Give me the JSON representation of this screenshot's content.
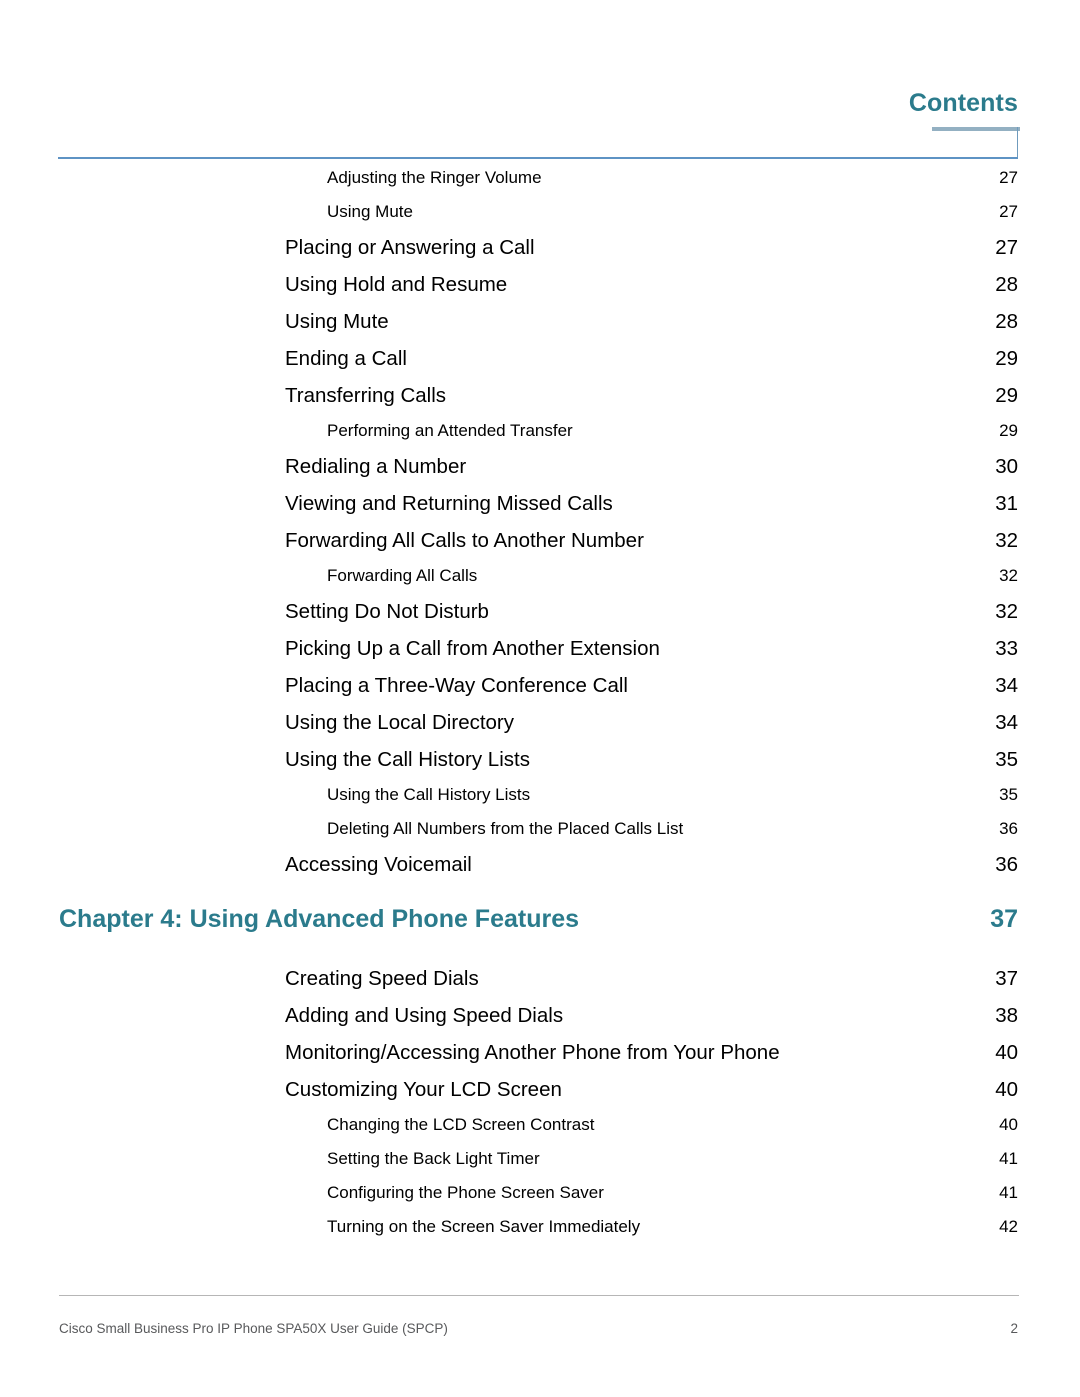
{
  "header": {
    "title": "Contents",
    "accent_color": "#2b7b8c",
    "bar_color": "#93b0c2",
    "rule_color": "#5e93c4"
  },
  "toc": {
    "entries": [
      {
        "level": 2,
        "label": "Adjusting the Ringer Volume",
        "page": "27"
      },
      {
        "level": 2,
        "label": "Using Mute",
        "page": "27"
      },
      {
        "level": 1,
        "label": "Placing or Answering a Call",
        "page": "27"
      },
      {
        "level": 1,
        "label": "Using Hold and Resume",
        "page": "28"
      },
      {
        "level": 1,
        "label": "Using Mute",
        "page": "28"
      },
      {
        "level": 1,
        "label": "Ending a Call",
        "page": "29"
      },
      {
        "level": 1,
        "label": "Transferring Calls",
        "page": "29"
      },
      {
        "level": 2,
        "label": "Performing an Attended Transfer",
        "page": "29"
      },
      {
        "level": 1,
        "label": "Redialing a Number",
        "page": "30"
      },
      {
        "level": 1,
        "label": "Viewing and Returning Missed Calls",
        "page": "31"
      },
      {
        "level": 1,
        "label": "Forwarding All Calls to Another Number",
        "page": "32"
      },
      {
        "level": 2,
        "label": "Forwarding All Calls",
        "page": "32"
      },
      {
        "level": 1,
        "label": "Setting Do Not Disturb",
        "page": "32"
      },
      {
        "level": 1,
        "label": "Picking Up a Call from Another Extension",
        "page": "33"
      },
      {
        "level": 1,
        "label": "Placing a Three-Way Conference Call",
        "page": "34"
      },
      {
        "level": 1,
        "label": "Using the Local Directory",
        "page": "34"
      },
      {
        "level": 1,
        "label": "Using the Call History Lists",
        "page": "35"
      },
      {
        "level": 2,
        "label": "Using the Call History Lists",
        "page": "35"
      },
      {
        "level": 2,
        "label": "Deleting All Numbers from the Placed Calls List",
        "page": "36"
      },
      {
        "level": 1,
        "label": "Accessing Voicemail",
        "page": "36"
      },
      {
        "level": 0,
        "label": "Chapter 4: Using Advanced Phone Features",
        "page": "37"
      },
      {
        "level": 1,
        "label": "Creating Speed Dials",
        "page": "37"
      },
      {
        "level": 1,
        "label": "Adding and Using Speed Dials",
        "page": "38"
      },
      {
        "level": 1,
        "label": "Monitoring/Accessing Another Phone from Your Phone",
        "page": "40"
      },
      {
        "level": 1,
        "label": "Customizing Your LCD Screen",
        "page": "40"
      },
      {
        "level": 2,
        "label": "Changing the LCD Screen Contrast",
        "page": "40"
      },
      {
        "level": 2,
        "label": "Setting the Back Light Timer",
        "page": "41"
      },
      {
        "level": 2,
        "label": "Configuring the Phone Screen Saver",
        "page": "41"
      },
      {
        "level": 2,
        "label": "Turning on the Screen Saver Immediately",
        "page": "42"
      }
    ]
  },
  "footer": {
    "text": "Cisco Small Business Pro IP Phone SPA50X User Guide (SPCP)",
    "page": "2"
  }
}
